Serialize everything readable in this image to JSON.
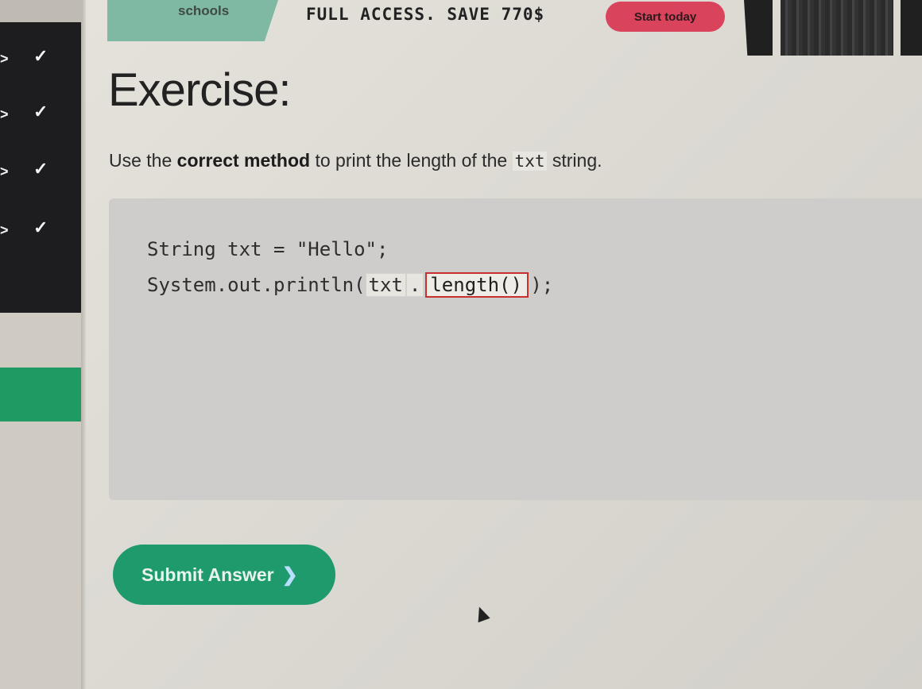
{
  "header": {
    "logo_text": "schools",
    "promo_text": "FULL ACCESS. SAVE 770$",
    "start_button": "Start today"
  },
  "sidebar": {
    "items": [
      {
        "arrow": ">",
        "check": "✓"
      },
      {
        "arrow": ">",
        "check": "✓"
      },
      {
        "arrow": ">",
        "check": "✓"
      },
      {
        "arrow": ">",
        "check": "✓"
      }
    ]
  },
  "exercise": {
    "heading": "Exercise:",
    "instruction_pre": "Use the ",
    "instruction_bold": "correct method",
    "instruction_mid": " to print the length of the ",
    "instruction_code": "txt",
    "instruction_post": " string.",
    "code_line_1": "String txt = \"Hello\";",
    "code_line_2_prefix": "System.out.println(",
    "code_line_2_var": "txt",
    "code_line_2_dot": ".",
    "answer_value": "length()",
    "code_line_2_suffix": ");"
  },
  "submit": {
    "label": "Submit Answer",
    "chevron": "❯"
  },
  "colors": {
    "brand_green": "#1f9a6c",
    "start_red": "#d9435b",
    "sidebar_dark": "#1d1d1f",
    "input_border": "#c8302f"
  },
  "icons": [
    "check-icon",
    "chevron-right-icon",
    "mouse-cursor-icon"
  ]
}
